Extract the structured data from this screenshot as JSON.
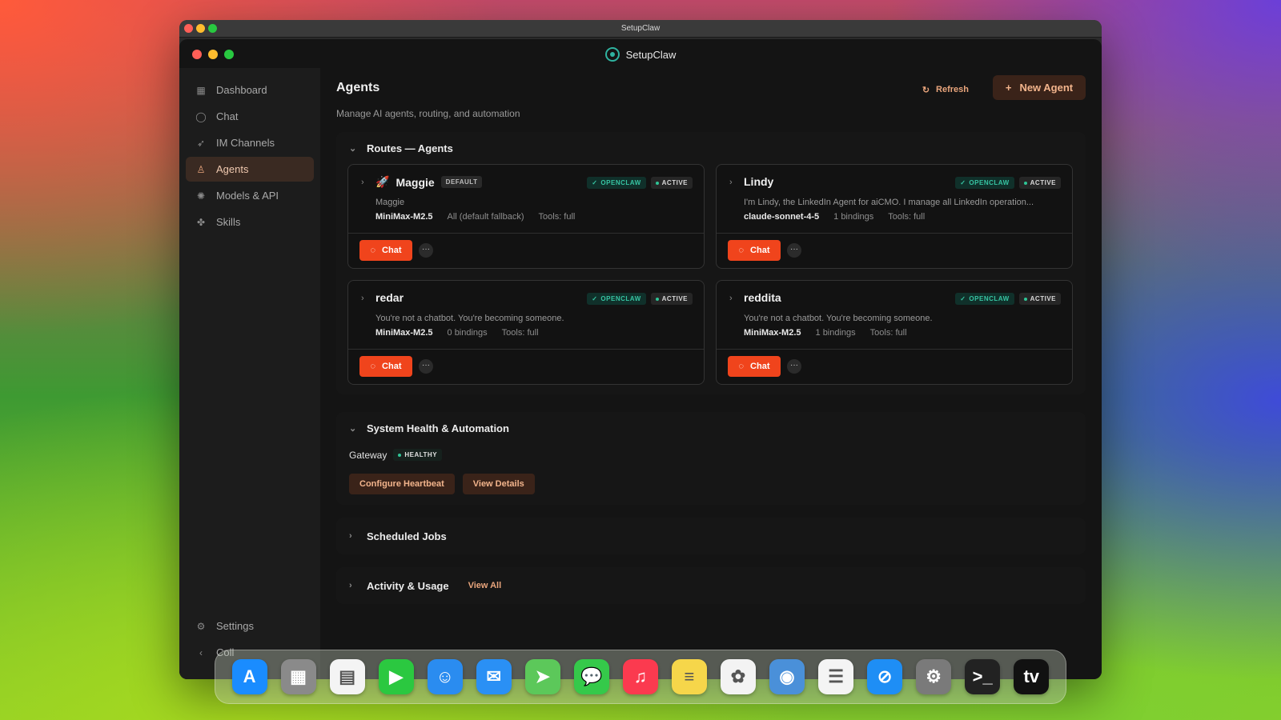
{
  "window": {
    "outer_title": "SetupClaw",
    "app_title": "SetupClaw"
  },
  "sidebar": {
    "items": [
      {
        "label": "Dashboard",
        "icon": "grid-icon",
        "active": false
      },
      {
        "label": "Chat",
        "icon": "chat-bubble-icon",
        "active": false
      },
      {
        "label": "IM Channels",
        "icon": "rocket-icon",
        "active": false
      },
      {
        "label": "Agents",
        "icon": "agent-icon",
        "active": true
      },
      {
        "label": "Models & API",
        "icon": "brain-icon",
        "active": false
      },
      {
        "label": "Skills",
        "icon": "puzzle-icon",
        "active": false
      }
    ],
    "settings_label": "Settings",
    "collapse_label": "Coll"
  },
  "header": {
    "title": "Agents",
    "refresh_label": "Refresh",
    "new_agent_label": "New Agent",
    "subtitle": "Manage AI agents, routing, and automation"
  },
  "routes_section": {
    "title": "Routes — Agents",
    "agents": [
      {
        "name": "Maggie",
        "emoji": "🚀",
        "default_badge": "DEFAULT",
        "openclaw": "OPENCLAW",
        "status": "ACTIVE",
        "description": "Maggie",
        "model": "MiniMax-M2.5",
        "bindings": "All (default fallback)",
        "tools": "Tools: full",
        "chat_label": "Chat"
      },
      {
        "name": "Lindy",
        "emoji": "",
        "default_badge": "",
        "openclaw": "OPENCLAW",
        "status": "ACTIVE",
        "description": "I'm Lindy, the LinkedIn Agent for aiCMO. I manage all LinkedIn operation...",
        "model": "claude-sonnet-4-5",
        "bindings": "1 bindings",
        "tools": "Tools: full",
        "chat_label": "Chat"
      },
      {
        "name": "redar",
        "emoji": "",
        "default_badge": "",
        "openclaw": "OPENCLAW",
        "status": "ACTIVE",
        "description": "You're not a chatbot. You're becoming someone.",
        "model": "MiniMax-M2.5",
        "bindings": "0 bindings",
        "tools": "Tools: full",
        "chat_label": "Chat"
      },
      {
        "name": "reddita",
        "emoji": "",
        "default_badge": "",
        "openclaw": "OPENCLAW",
        "status": "ACTIVE",
        "description": "You're not a chatbot. You're becoming someone.",
        "model": "MiniMax-M2.5",
        "bindings": "1 bindings",
        "tools": "Tools: full",
        "chat_label": "Chat"
      }
    ]
  },
  "health_section": {
    "title": "System Health & Automation",
    "gateway_label": "Gateway",
    "gateway_status": "HEALTHY",
    "configure_label": "Configure Heartbeat",
    "details_label": "View Details"
  },
  "scheduled_section": {
    "title": "Scheduled Jobs"
  },
  "activity_section": {
    "title": "Activity & Usage",
    "view_all_label": "View All"
  },
  "dock": {
    "apps": [
      {
        "name": "app-store",
        "glyph": "A",
        "color": "#1a8cff"
      },
      {
        "name": "calculator",
        "glyph": "▦",
        "color": "#8a8a8a"
      },
      {
        "name": "calendar",
        "glyph": "▤",
        "color": "#f4f4f4"
      },
      {
        "name": "facetime",
        "glyph": "▶",
        "color": "#2bc840"
      },
      {
        "name": "finder",
        "glyph": "☺",
        "color": "#2a8cf0"
      },
      {
        "name": "mail",
        "glyph": "✉",
        "color": "#2a90f5"
      },
      {
        "name": "maps",
        "glyph": "➤",
        "color": "#5cc85a"
      },
      {
        "name": "messages",
        "glyph": "💬",
        "color": "#35c94a"
      },
      {
        "name": "music",
        "glyph": "♫",
        "color": "#fb3a4f"
      },
      {
        "name": "notes",
        "glyph": "≡",
        "color": "#f6d64a"
      },
      {
        "name": "photos",
        "glyph": "✿",
        "color": "#f3f3f3"
      },
      {
        "name": "preview",
        "glyph": "◉",
        "color": "#4a90d9"
      },
      {
        "name": "reminders",
        "glyph": "☰",
        "color": "#f4f4f4"
      },
      {
        "name": "safari",
        "glyph": "⊘",
        "color": "#1e8ef5"
      },
      {
        "name": "system-settings",
        "glyph": "⚙",
        "color": "#7a7a7a"
      },
      {
        "name": "terminal",
        "glyph": ">_",
        "color": "#222222"
      },
      {
        "name": "apple-tv",
        "glyph": "tv",
        "color": "#111111"
      }
    ]
  }
}
